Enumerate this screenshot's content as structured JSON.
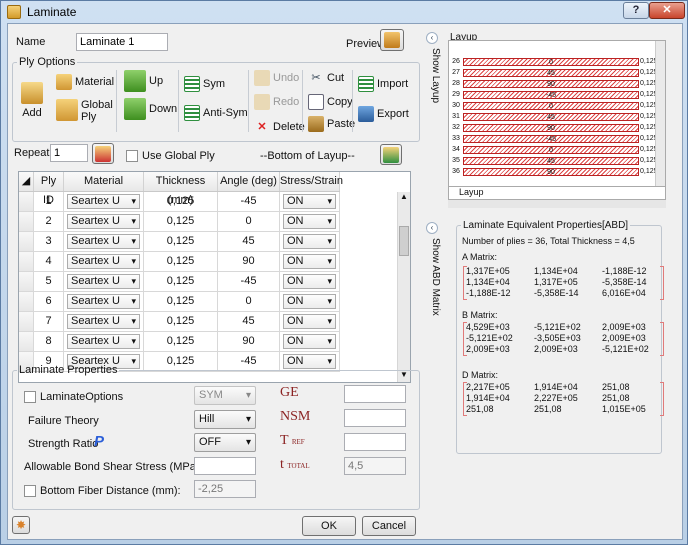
{
  "window": {
    "title": "Laminate",
    "help_label": "?",
    "close_label": "✕"
  },
  "name": {
    "label": "Name",
    "value": "Laminate 1"
  },
  "preview_label": "Preview",
  "ply_options": {
    "legend": "Ply Options",
    "add": "Add",
    "material": "Material",
    "global_ply": "Global Ply",
    "up": "Up",
    "down": "Down",
    "sym": "Sym",
    "anti_sym": "Anti-Sym",
    "undo": "Undo",
    "redo": "Redo",
    "delete": "Delete",
    "cut": "Cut",
    "copy": "Copy",
    "paste": "Paste",
    "import": "Import",
    "export": "Export"
  },
  "repeat": {
    "label": "Repeat",
    "value": "1"
  },
  "use_global_ply": "Use Global Ply",
  "bottom_label": "--Bottom of Layup--",
  "grid": {
    "headers": [
      "Ply ID",
      "Material",
      "Thickness (mm)",
      "Angle (deg)",
      "Stress/Strain"
    ],
    "rows": [
      {
        "id": "1",
        "material": "Seartex U",
        "thickness": "0,125",
        "angle": "-45",
        "stress": "ON"
      },
      {
        "id": "2",
        "material": "Seartex U",
        "thickness": "0,125",
        "angle": "0",
        "stress": "ON"
      },
      {
        "id": "3",
        "material": "Seartex U",
        "thickness": "0,125",
        "angle": "45",
        "stress": "ON"
      },
      {
        "id": "4",
        "material": "Seartex U",
        "thickness": "0,125",
        "angle": "90",
        "stress": "ON"
      },
      {
        "id": "5",
        "material": "Seartex U",
        "thickness": "0,125",
        "angle": "-45",
        "stress": "ON"
      },
      {
        "id": "6",
        "material": "Seartex U",
        "thickness": "0,125",
        "angle": "0",
        "stress": "ON"
      },
      {
        "id": "7",
        "material": "Seartex U",
        "thickness": "0,125",
        "angle": "45",
        "stress": "ON"
      },
      {
        "id": "8",
        "material": "Seartex U",
        "thickness": "0,125",
        "angle": "90",
        "stress": "ON"
      },
      {
        "id": "9",
        "material": "Seartex U",
        "thickness": "0,125",
        "angle": "-45",
        "stress": "ON"
      }
    ]
  },
  "laminate_properties": {
    "legend": "Laminate Properties",
    "laminate_options": "LaminateOptions",
    "laminate_options_value": "SYM",
    "failure_theory": "Failure Theory",
    "failure_theory_value": "Hill",
    "strength_ratio": "Strength Ratio",
    "strength_ratio_symbol": "P",
    "strength_ratio_value": "OFF",
    "bond_shear": "Allowable Bond Shear Stress (MPa):",
    "bottom_fiber": "Bottom Fiber Distance (mm):",
    "bottom_fiber_value": "-2,25",
    "ge": "GE",
    "nsm": "NSM",
    "tref": "T",
    "tref_sub": "REF",
    "ttotal": "t",
    "ttotal_sub": "TOTAL",
    "ttotal_value": "4,5"
  },
  "buttons": {
    "ok": "OK",
    "cancel": "Cancel"
  },
  "show_layup": "Show Layup",
  "show_abd": "Show ABD Matrix",
  "layup": {
    "title": "Layup",
    "footer": "Layup",
    "rows": [
      {
        "n": "26",
        "angle": "0",
        "t": "0,125"
      },
      {
        "n": "27",
        "angle": "45",
        "t": "0,125"
      },
      {
        "n": "28",
        "angle": "90",
        "t": "0,125"
      },
      {
        "n": "29",
        "angle": "-45",
        "t": "0,125"
      },
      {
        "n": "30",
        "angle": "0",
        "t": "0,125"
      },
      {
        "n": "31",
        "angle": "45",
        "t": "0,125"
      },
      {
        "n": "32",
        "angle": "90",
        "t": "0,125"
      },
      {
        "n": "33",
        "angle": "-45",
        "t": "0,125"
      },
      {
        "n": "34",
        "angle": "0",
        "t": "0,125"
      },
      {
        "n": "35",
        "angle": "45",
        "t": "0,125"
      },
      {
        "n": "36",
        "angle": "90",
        "t": "0,125"
      }
    ]
  },
  "abd": {
    "legend": "Laminate Equivalent Properties[ABD]",
    "summary": "Number of plies = 36, Total Thickness = 4,5",
    "a_title": "A Matrix:",
    "a": [
      [
        "1,317E+05",
        "1,134E+04",
        "-1,188E-12"
      ],
      [
        "1,134E+04",
        "1,317E+05",
        "-5,358E-14"
      ],
      [
        "-1,188E-12",
        "-5,358E-14",
        "6,016E+04"
      ]
    ],
    "b_title": "B Matrix:",
    "b": [
      [
        "4,529E+03",
        "-5,121E+02",
        "2,009E+03"
      ],
      [
        "-5,121E+02",
        "-3,505E+03",
        "2,009E+03"
      ],
      [
        "2,009E+03",
        "2,009E+03",
        "-5,121E+02"
      ]
    ],
    "d_title": "D Matrix:",
    "d": [
      [
        "2,217E+05",
        "1,914E+04",
        "251,08"
      ],
      [
        "1,914E+04",
        "2,227E+05",
        "251,08"
      ],
      [
        "251,08",
        "251,08",
        "1,015E+05"
      ]
    ]
  }
}
